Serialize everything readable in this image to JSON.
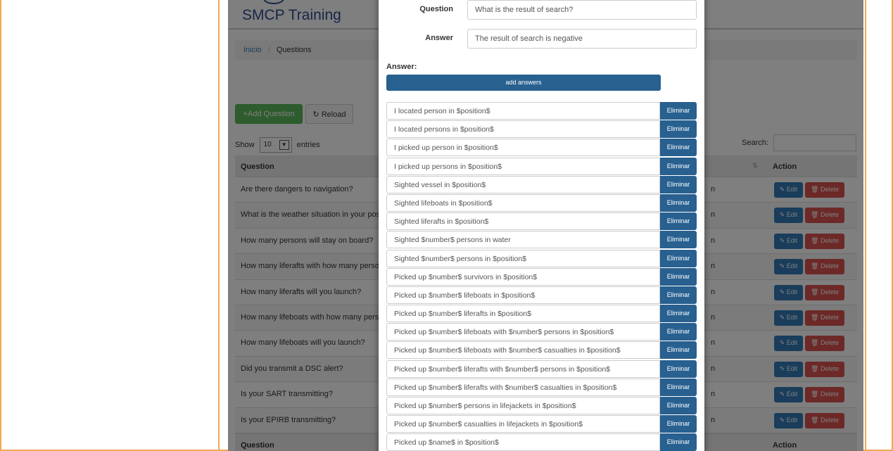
{
  "app": {
    "brand": "SMCP Training"
  },
  "breadcrumb": {
    "home": "Inicio",
    "sep": "/",
    "current": "Questions"
  },
  "toolbar": {
    "add_label": "+Add Question",
    "reload_label": "Reload",
    "reload_icon": "refresh-icon"
  },
  "table_controls": {
    "show_label": "Show",
    "entries_value": "10",
    "entries_label": "entries",
    "search_label": "Search:"
  },
  "table": {
    "header_question": "Question",
    "header_action": "Action",
    "footer_question": "Question",
    "footer_action": "Action",
    "edit_label": "Edit",
    "delete_label": "Delete",
    "rows": [
      {
        "question": "Are there dangers to navigation?",
        "tail": "n"
      },
      {
        "question": "What is the weather situation in your pos",
        "tail": "n"
      },
      {
        "question": "How many persons will stay on board?",
        "tail": "n"
      },
      {
        "question": "How many liferafts with how many persor",
        "tail": "n"
      },
      {
        "question": "How many liferafts will you launch?",
        "tail": "n"
      },
      {
        "question": "How many lifeboats with how many perso",
        "tail": "n"
      },
      {
        "question": "How many lifeboats will you launch?",
        "tail": "n"
      },
      {
        "question": "Did you transmit a DSC alert?",
        "tail": "n"
      },
      {
        "question": "Is your SART transmitting?",
        "tail": "n"
      },
      {
        "question": "Is your EPIRB transmitting?",
        "tail": "n"
      }
    ]
  },
  "modal": {
    "question_label": "Question",
    "question_value": "What is the result of search?",
    "answer_label": "Answer",
    "answer_value": "The result of search is negative",
    "answers_heading": "Answer:",
    "add_answers_label": "add answers",
    "remove_label": "Eliminar",
    "answers": [
      "I located person in $position$",
      "I located persons in $position$",
      "I picked up person in $position$",
      "I picked up persons in $position$",
      "Sighted vessel in $position$",
      "Sighted lifeboats in $position$",
      "Sighted liferafts in $position$",
      "Sighted $number$ persons in water",
      "Sighted $number$ persons in $position$",
      "Picked up $number$ survivors in $position$",
      "Picked up $number$ lifeboats in $position$",
      "Picked up $number$ liferafts in $position$",
      "Picked up $number$ lifeboats with $number$ persons in $position$",
      "Picked up $number$ lifeboats with $number$ casualties in $position$",
      "Picked up $number$ liferafts with $number$ persons in $position$",
      "Picked up $number$ liferafts with $number$ casualties in $position$",
      "Picked up $number$ persons in lifejackets in $position$",
      "Picked up $number$ casualties in lifejackets in $position$",
      "Picked up $name$ in $position$"
    ]
  },
  "colors": {
    "frame": "#f0a858",
    "primary": "#286090",
    "success": "#5cb85c",
    "danger": "#d9534f",
    "brand": "#2f4f8f"
  }
}
